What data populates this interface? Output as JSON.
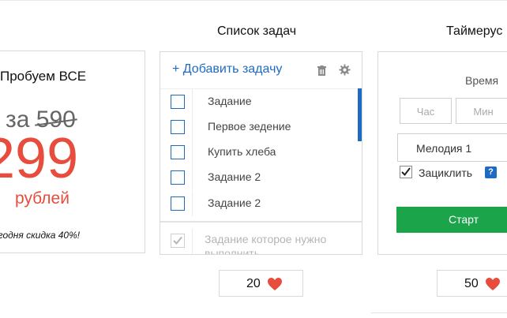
{
  "columns": {
    "tasks_title": "Список задач",
    "timer_title": "Таймерус"
  },
  "promo": {
    "title": "Пробуем ВСЕ",
    "old_prefix": "за",
    "old_price": "590",
    "price": "299",
    "unit": "рублей",
    "note": "егодня скидка 40%!"
  },
  "tasks": {
    "add_label": "+ Добавить задачу",
    "items": [
      {
        "label": "Задание"
      },
      {
        "label": "Первое зедение"
      },
      {
        "label": "Купить хлеба"
      },
      {
        "label": "Задание 2"
      },
      {
        "label": "Задание 2"
      }
    ],
    "done_item": "Задание которое нужно выполнить",
    "likes": "20"
  },
  "timer": {
    "time_label": "Время",
    "hours_placeholder": "Час",
    "minutes_placeholder": "Мин",
    "melody": "Мелодия 1",
    "loop_label": "Зациклить",
    "help": "?",
    "start_label": "Старт",
    "likes": "50"
  },
  "colors": {
    "accent": "#1d6bc2",
    "price": "#e74c3c",
    "start": "#1ca44a",
    "heart": "#e74c3c"
  },
  "icons": [
    "trash-icon",
    "gear-icon",
    "heart-icon",
    "checkmark-icon"
  ]
}
